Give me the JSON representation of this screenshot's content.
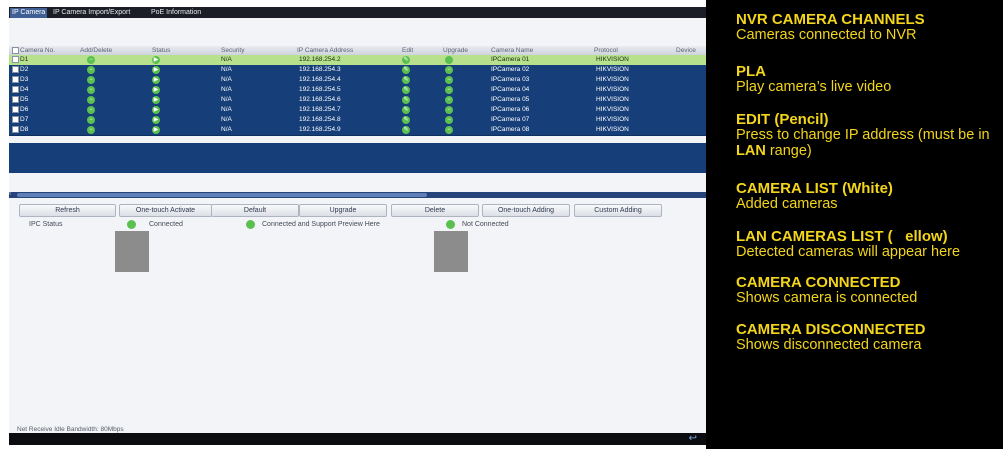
{
  "tabs": [
    "IP Camera",
    "IP Camera Import/Export",
    "PoE Information"
  ],
  "table": {
    "columns": [
      "Camera No.",
      "Add/Delete",
      "Status",
      "Security",
      "IP Camera Address",
      "Edit",
      "Upgrade",
      "Camera Name",
      "Protocol",
      "Device"
    ],
    "rows": [
      {
        "no": "D1",
        "security": "N/A",
        "ip": "192.168.254.2",
        "name": "IPCamera 01",
        "protocol": "HIKVISION"
      },
      {
        "no": "D2",
        "security": "N/A",
        "ip": "192.168.254.3",
        "name": "IPCamera 02",
        "protocol": "HIKVISION"
      },
      {
        "no": "D3",
        "security": "N/A",
        "ip": "192.168.254.4",
        "name": "IPCamera 03",
        "protocol": "HIKVISION"
      },
      {
        "no": "D4",
        "security": "N/A",
        "ip": "192.168.254.5",
        "name": "IPCamera 04",
        "protocol": "HIKVISION"
      },
      {
        "no": "D5",
        "security": "N/A",
        "ip": "192.168.254.6",
        "name": "IPCamera 05",
        "protocol": "HIKVISION"
      },
      {
        "no": "D6",
        "security": "N/A",
        "ip": "192.168.254.7",
        "name": "IPCamera 06",
        "protocol": "HIKVISION"
      },
      {
        "no": "D7",
        "security": "N/A",
        "ip": "192.168.254.8",
        "name": "IPCamera 07",
        "protocol": "HIKVISION"
      },
      {
        "no": "D8",
        "security": "N/A",
        "ip": "192.168.254.9",
        "name": "IPCamera 08",
        "protocol": "HIKVISION"
      }
    ]
  },
  "buttons": [
    "Refresh",
    "One-touch Activate",
    "Default",
    "Upgrade",
    "Delete",
    "One-touch Adding",
    "Custom Adding"
  ],
  "ipc_status": {
    "label": "IPC Status",
    "connected": "Connected",
    "connected_preview": "Connected and Support Preview Here",
    "not_connected": "Not Connected"
  },
  "footer": "Net Receive Idle Bandwidth: 80Mbps",
  "annotations": [
    {
      "title": "NVR CAMERA CHANNELS",
      "desc": "Cameras connected to NVR"
    },
    {
      "title": "PLA",
      "desc": "Play camera’s live video"
    },
    {
      "title": "EDIT (Pencil)",
      "desc_a": "Press to change IP address (must be in ",
      "desc_bold": "LAN",
      "desc_b": " range)"
    },
    {
      "title": "CAMERA LIST (White)",
      "desc": "Added cameras"
    },
    {
      "title": "LAN CAMERAS LIST (   ellow)",
      "desc": "Detected cameras will appear here"
    },
    {
      "title": "CAMERA CONNECTED",
      "desc": "Shows camera is connected"
    },
    {
      "title": "CAMERA DISCONNECTED",
      "desc": "Shows disconnected camera"
    }
  ],
  "colors": {
    "annotation_text": "#f3d51b",
    "row_blue": "#163f7a",
    "row_selected": "#b8e18e",
    "status_green": "#5bc04f",
    "tab_active": "#3f5f95"
  }
}
